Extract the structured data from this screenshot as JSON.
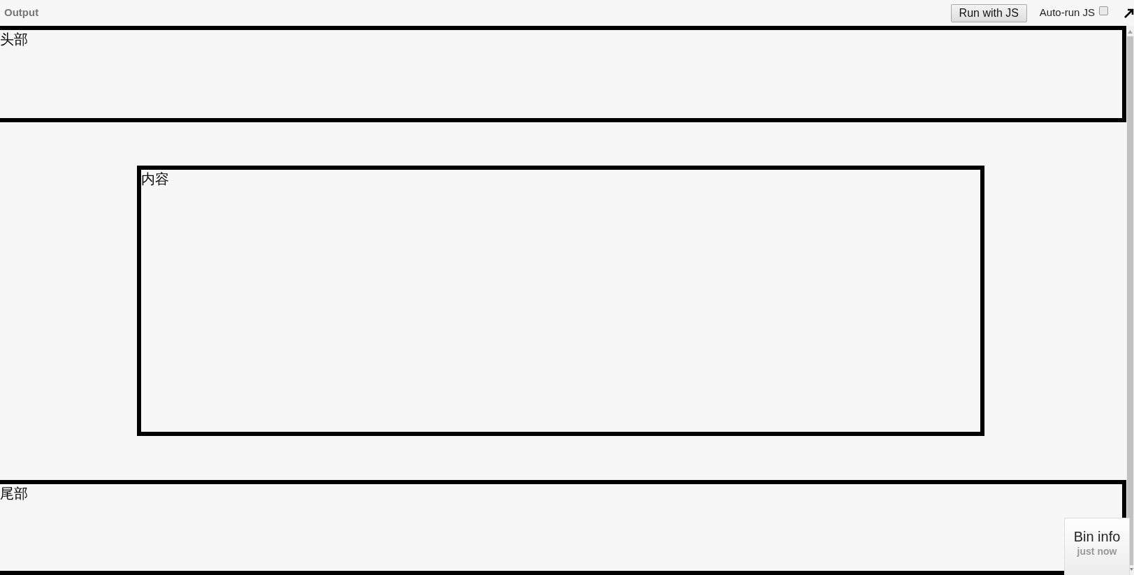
{
  "toolbar": {
    "title": "Output",
    "run_button": "Run with JS",
    "auto_run": {
      "label": "Auto-run JS",
      "checked": false
    }
  },
  "panels": [
    {
      "kind": "header",
      "label": "头部"
    },
    {
      "kind": "content",
      "label": "内容"
    },
    {
      "kind": "footer",
      "label": "尾部"
    }
  ],
  "bin_info": {
    "title": "Bin info",
    "time": "just now"
  }
}
